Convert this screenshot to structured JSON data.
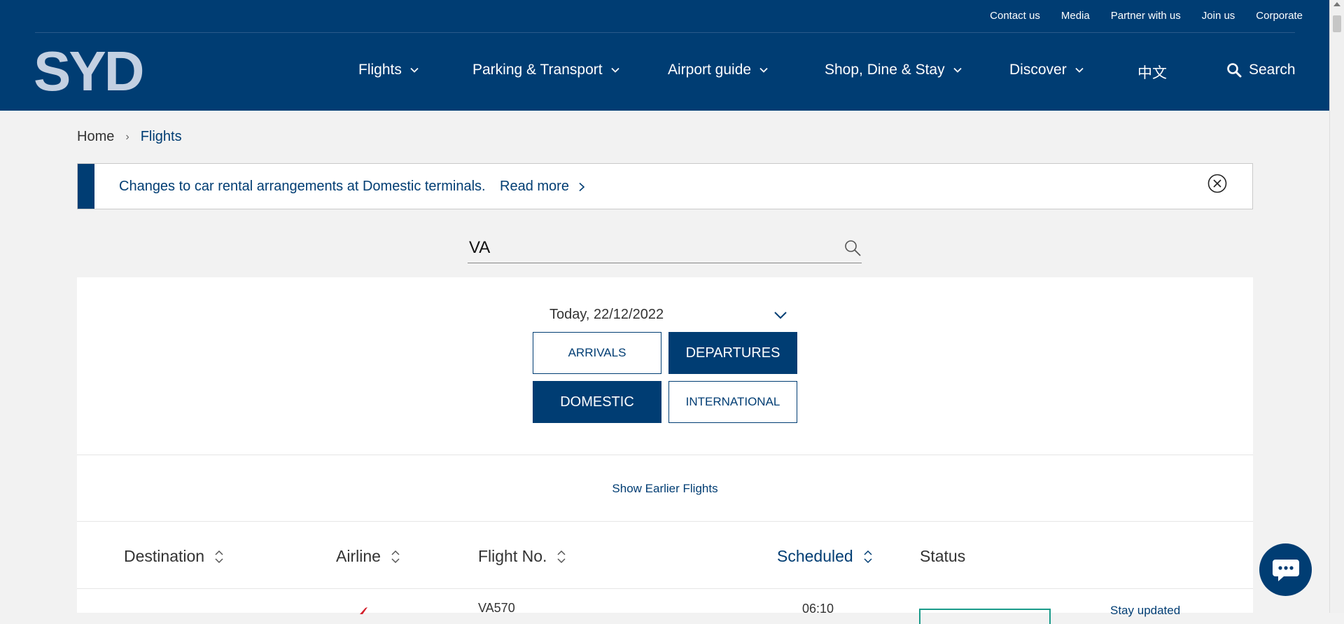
{
  "utility_nav": [
    "Contact us",
    "Media",
    "Partner with us",
    "Join us",
    "Corporate"
  ],
  "logo_text": "SYD",
  "main_nav": {
    "flights": "Flights",
    "parking": "Parking & Transport",
    "guide": "Airport guide",
    "shop": "Shop, Dine & Stay",
    "discover": "Discover",
    "chinese": "中文",
    "search": "Search"
  },
  "breadcrumb": {
    "home": "Home",
    "current": "Flights"
  },
  "alert": {
    "text": "Changes to car rental arrangements at Domestic terminals.",
    "link": "Read more"
  },
  "search": {
    "value": "VA"
  },
  "date_select": {
    "value": "Today, 22/12/2022"
  },
  "direction": {
    "arrivals": "ARRIVALS",
    "departures": "DEPARTURES"
  },
  "type": {
    "domestic": "DOMESTIC",
    "international": "INTERNATIONAL"
  },
  "earlier_flights": "Show Earlier Flights",
  "table": {
    "columns": {
      "destination": "Destination",
      "airline": "Airline",
      "flight_no": "Flight No.",
      "scheduled": "Scheduled",
      "status": "Status"
    },
    "first_row": {
      "flight_no": "VA570",
      "scheduled": "06:10",
      "action": "Stay updated"
    }
  },
  "colors": {
    "primary": "#003d73",
    "status_border": "#1a9b8a"
  }
}
